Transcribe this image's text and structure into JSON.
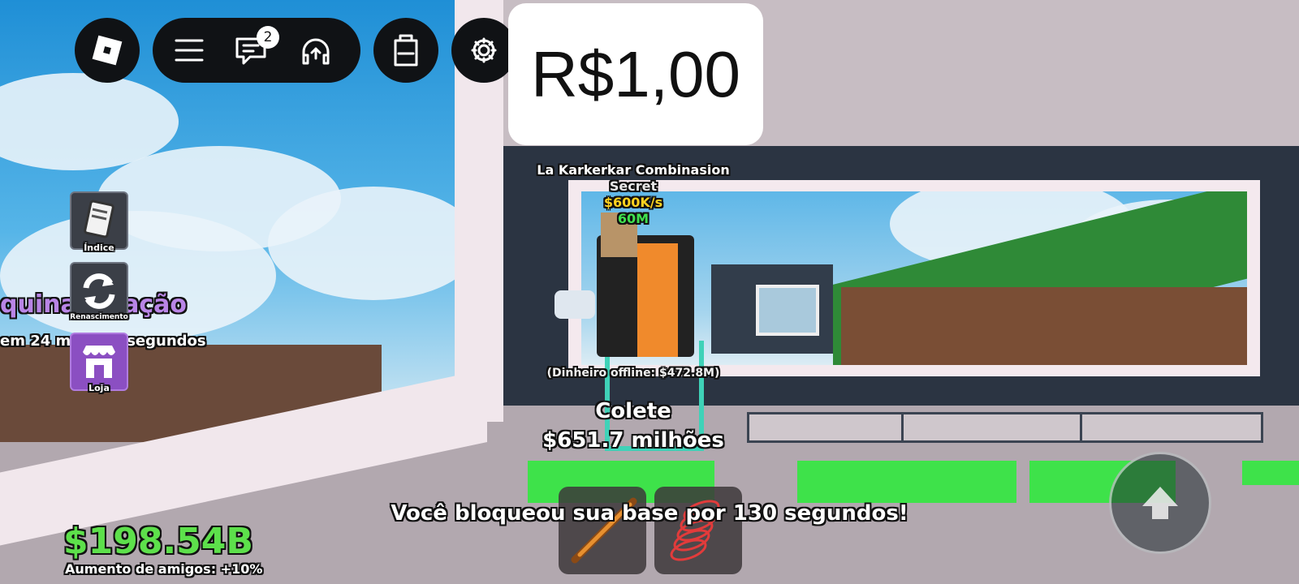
{
  "top_bar": {
    "chat_badge_count": "2",
    "icons": [
      "roblox-logo-icon",
      "menu-icon",
      "chat-icon",
      "headset-icon",
      "backpack-icon",
      "settings-gear-icon"
    ]
  },
  "price_popup": {
    "text": "R$1,00"
  },
  "brainrot_label": {
    "name": "La Karkerkar Combinasion",
    "rarity": "Secret",
    "rate": "$600K/s",
    "price": "60M"
  },
  "offline_money": "(Dinheiro offline: $472.8M)",
  "collect": {
    "title": "Colete",
    "amount": "$651.7 milhões"
  },
  "left_sign": {
    "title": "quina   riação",
    "subtitle": "em 24 m      21 segundos"
  },
  "side_menu": [
    {
      "label": "Índice",
      "icon": "book-icon"
    },
    {
      "label": "Renascimento",
      "icon": "rebirth-arrows-icon"
    },
    {
      "label": "Loja",
      "icon": "shop-icon"
    }
  ],
  "notification": "Você bloqueou sua base por 130 segundos!",
  "money": {
    "value": "$198.54B",
    "friends_boost": "Aumento de amigos: +10%"
  },
  "hotbar": [
    {
      "icon": "bat-icon"
    },
    {
      "icon": "coil-spring-icon"
    }
  ],
  "colors": {
    "money_green": "#5de04b",
    "rate_yellow": "#ffd21f",
    "price_green": "#3fe04e",
    "sign_purple": "#9b5fd0"
  }
}
